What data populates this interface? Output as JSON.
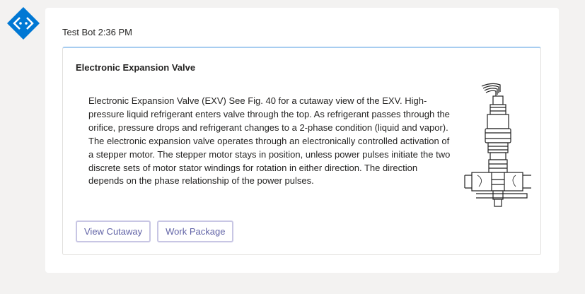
{
  "sender": {
    "name": "Test Bot",
    "time": "2:36 PM"
  },
  "card": {
    "title": "Electronic Expansion Valve",
    "body": "Electronic Expansion Valve (EXV) See Fig. 40 for a cutaway view of the EXV. High-pressure liquid refrigerant enters valve through the top. As refrigerant passes through the orifice, pressure drops and refrigerant changes to a 2-phase condition (liquid and vapor). The electronic expansion valve operates through an electronically controlled activation of a stepper motor. The stepper motor stays in position, unless power pulses initiate the two discrete sets of motor stator windings for rotation in either direction. The direction depends on the phase relationship of the power pulses.",
    "actions": [
      {
        "label": "View Cutaway"
      },
      {
        "label": "Work Package"
      }
    ]
  },
  "icons": {
    "avatar": "bot-avatar-icon",
    "image": "expansion-valve-image"
  },
  "colors": {
    "accent": "#6264a7",
    "avatar": "#0078d4",
    "card_top_border": "#a7cdf0"
  }
}
